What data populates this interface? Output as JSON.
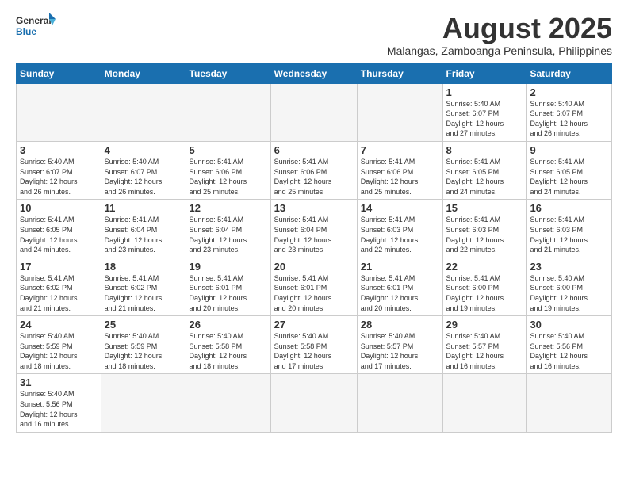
{
  "header": {
    "logo_general": "General",
    "logo_blue": "Blue",
    "title": "August 2025",
    "subtitle": "Malangas, Zamboanga Peninsula, Philippines"
  },
  "days_of_week": [
    "Sunday",
    "Monday",
    "Tuesday",
    "Wednesday",
    "Thursday",
    "Friday",
    "Saturday"
  ],
  "weeks": [
    [
      {
        "num": "",
        "info": ""
      },
      {
        "num": "",
        "info": ""
      },
      {
        "num": "",
        "info": ""
      },
      {
        "num": "",
        "info": ""
      },
      {
        "num": "",
        "info": ""
      },
      {
        "num": "1",
        "info": "Sunrise: 5:40 AM\nSunset: 6:07 PM\nDaylight: 12 hours\nand 27 minutes."
      },
      {
        "num": "2",
        "info": "Sunrise: 5:40 AM\nSunset: 6:07 PM\nDaylight: 12 hours\nand 26 minutes."
      }
    ],
    [
      {
        "num": "3",
        "info": "Sunrise: 5:40 AM\nSunset: 6:07 PM\nDaylight: 12 hours\nand 26 minutes."
      },
      {
        "num": "4",
        "info": "Sunrise: 5:40 AM\nSunset: 6:07 PM\nDaylight: 12 hours\nand 26 minutes."
      },
      {
        "num": "5",
        "info": "Sunrise: 5:41 AM\nSunset: 6:06 PM\nDaylight: 12 hours\nand 25 minutes."
      },
      {
        "num": "6",
        "info": "Sunrise: 5:41 AM\nSunset: 6:06 PM\nDaylight: 12 hours\nand 25 minutes."
      },
      {
        "num": "7",
        "info": "Sunrise: 5:41 AM\nSunset: 6:06 PM\nDaylight: 12 hours\nand 25 minutes."
      },
      {
        "num": "8",
        "info": "Sunrise: 5:41 AM\nSunset: 6:05 PM\nDaylight: 12 hours\nand 24 minutes."
      },
      {
        "num": "9",
        "info": "Sunrise: 5:41 AM\nSunset: 6:05 PM\nDaylight: 12 hours\nand 24 minutes."
      }
    ],
    [
      {
        "num": "10",
        "info": "Sunrise: 5:41 AM\nSunset: 6:05 PM\nDaylight: 12 hours\nand 24 minutes."
      },
      {
        "num": "11",
        "info": "Sunrise: 5:41 AM\nSunset: 6:04 PM\nDaylight: 12 hours\nand 23 minutes."
      },
      {
        "num": "12",
        "info": "Sunrise: 5:41 AM\nSunset: 6:04 PM\nDaylight: 12 hours\nand 23 minutes."
      },
      {
        "num": "13",
        "info": "Sunrise: 5:41 AM\nSunset: 6:04 PM\nDaylight: 12 hours\nand 23 minutes."
      },
      {
        "num": "14",
        "info": "Sunrise: 5:41 AM\nSunset: 6:03 PM\nDaylight: 12 hours\nand 22 minutes."
      },
      {
        "num": "15",
        "info": "Sunrise: 5:41 AM\nSunset: 6:03 PM\nDaylight: 12 hours\nand 22 minutes."
      },
      {
        "num": "16",
        "info": "Sunrise: 5:41 AM\nSunset: 6:03 PM\nDaylight: 12 hours\nand 21 minutes."
      }
    ],
    [
      {
        "num": "17",
        "info": "Sunrise: 5:41 AM\nSunset: 6:02 PM\nDaylight: 12 hours\nand 21 minutes."
      },
      {
        "num": "18",
        "info": "Sunrise: 5:41 AM\nSunset: 6:02 PM\nDaylight: 12 hours\nand 21 minutes."
      },
      {
        "num": "19",
        "info": "Sunrise: 5:41 AM\nSunset: 6:01 PM\nDaylight: 12 hours\nand 20 minutes."
      },
      {
        "num": "20",
        "info": "Sunrise: 5:41 AM\nSunset: 6:01 PM\nDaylight: 12 hours\nand 20 minutes."
      },
      {
        "num": "21",
        "info": "Sunrise: 5:41 AM\nSunset: 6:01 PM\nDaylight: 12 hours\nand 20 minutes."
      },
      {
        "num": "22",
        "info": "Sunrise: 5:41 AM\nSunset: 6:00 PM\nDaylight: 12 hours\nand 19 minutes."
      },
      {
        "num": "23",
        "info": "Sunrise: 5:40 AM\nSunset: 6:00 PM\nDaylight: 12 hours\nand 19 minutes."
      }
    ],
    [
      {
        "num": "24",
        "info": "Sunrise: 5:40 AM\nSunset: 5:59 PM\nDaylight: 12 hours\nand 18 minutes."
      },
      {
        "num": "25",
        "info": "Sunrise: 5:40 AM\nSunset: 5:59 PM\nDaylight: 12 hours\nand 18 minutes."
      },
      {
        "num": "26",
        "info": "Sunrise: 5:40 AM\nSunset: 5:58 PM\nDaylight: 12 hours\nand 18 minutes."
      },
      {
        "num": "27",
        "info": "Sunrise: 5:40 AM\nSunset: 5:58 PM\nDaylight: 12 hours\nand 17 minutes."
      },
      {
        "num": "28",
        "info": "Sunrise: 5:40 AM\nSunset: 5:57 PM\nDaylight: 12 hours\nand 17 minutes."
      },
      {
        "num": "29",
        "info": "Sunrise: 5:40 AM\nSunset: 5:57 PM\nDaylight: 12 hours\nand 16 minutes."
      },
      {
        "num": "30",
        "info": "Sunrise: 5:40 AM\nSunset: 5:56 PM\nDaylight: 12 hours\nand 16 minutes."
      }
    ],
    [
      {
        "num": "31",
        "info": "Sunrise: 5:40 AM\nSunset: 5:56 PM\nDaylight: 12 hours\nand 16 minutes."
      },
      {
        "num": "",
        "info": ""
      },
      {
        "num": "",
        "info": ""
      },
      {
        "num": "",
        "info": ""
      },
      {
        "num": "",
        "info": ""
      },
      {
        "num": "",
        "info": ""
      },
      {
        "num": "",
        "info": ""
      }
    ]
  ]
}
